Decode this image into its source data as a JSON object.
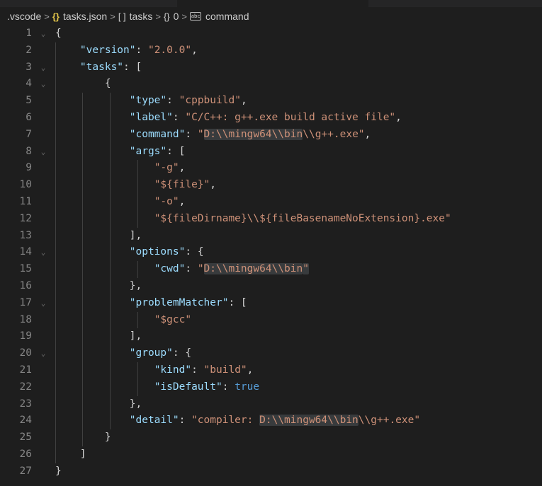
{
  "breadcrumb": {
    "folder": ".vscode",
    "file": "tasks.json",
    "file_icon": "{}",
    "array_icon": "[ ]",
    "array_name": "tasks",
    "object_icon": "{}",
    "object_name": "0",
    "string_icon": "abc",
    "string_name": "command",
    "separator": ">"
  },
  "editor": {
    "line_numbers": [
      "1",
      "2",
      "3",
      "4",
      "5",
      "6",
      "7",
      "8",
      "9",
      "10",
      "11",
      "12",
      "13",
      "14",
      "15",
      "16",
      "17",
      "18",
      "19",
      "20",
      "21",
      "22",
      "23",
      "24",
      "25",
      "26",
      "27"
    ],
    "tokens": {
      "l1_open": "{",
      "version_key": "\"version\"",
      "version_val": "\"2.0.0\"",
      "tasks_key": "\"tasks\"",
      "tasks_open": "[",
      "task_open": "{",
      "type_key": "\"type\"",
      "type_val": "\"cppbuild\"",
      "label_key": "\"label\"",
      "label_val": "\"C/C++: g++.exe build active file\"",
      "command_key": "\"command\"",
      "command_q1": "\"",
      "command_hl": "D:\\\\mingw64\\\\bin",
      "command_rest": "\\\\g++.exe\"",
      "args_key": "\"args\"",
      "args_open": "[",
      "arg1": "\"-g\"",
      "arg2": "\"${file}\"",
      "arg3": "\"-o\"",
      "arg4": "\"${fileDirname}\\\\${fileBasenameNoExtension}.exe\"",
      "args_close": "],",
      "options_key": "\"options\"",
      "options_open": "{",
      "cwd_key": "\"cwd\"",
      "cwd_q1": "\"",
      "cwd_hl": "D:\\\\mingw64\\\\bin",
      "cwd_q2": "\"",
      "options_close": "},",
      "pm_key": "\"problemMatcher\"",
      "pm_open": "[",
      "pm_val": "\"$gcc\"",
      "pm_close": "],",
      "group_key": "\"group\"",
      "group_open": "{",
      "kind_key": "\"kind\"",
      "kind_val": "\"build\"",
      "isdefault_key": "\"isDefault\"",
      "isdefault_val": "true",
      "group_close": "},",
      "detail_key": "\"detail\"",
      "detail_pre": "\"compiler: ",
      "detail_hl": "D:\\\\mingw64\\\\bin",
      "detail_rest": "\\\\g++.exe\"",
      "task_close": "}",
      "tasks_close": "]",
      "root_close": "}",
      "colon": ": ",
      "comma": ","
    }
  },
  "colors": {
    "background": "#1e1e1e",
    "key": "#9cdcfe",
    "string": "#ce9178",
    "keyword": "#569cd6",
    "punctuation": "#d4d4d4",
    "line_number": "#858585",
    "highlight": "#383b3d"
  },
  "icons": {
    "fold": "chevron-down-icon",
    "string_symbol": "string-symbol-icon"
  }
}
